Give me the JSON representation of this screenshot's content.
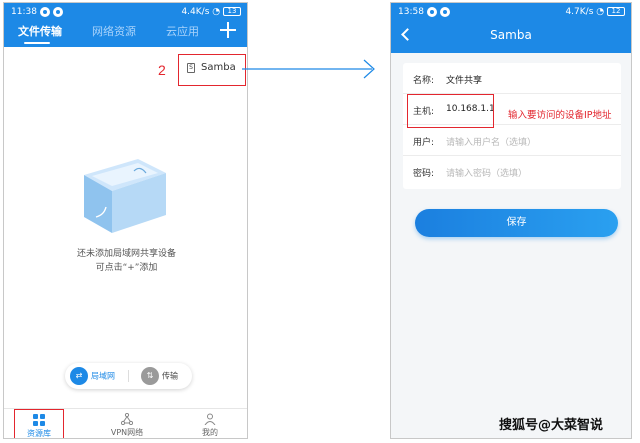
{
  "left_phone": {
    "status": {
      "time": "11:38",
      "speed": "4.4K/s",
      "battery": "13"
    },
    "tabs": [
      {
        "label": "文件传输"
      },
      {
        "label": "网络资源"
      },
      {
        "label": "云应用"
      }
    ],
    "step_number": "2",
    "add_menu": {
      "item_label": "Samba"
    },
    "empty_state": {
      "line1": "还未添加局域网共享设备",
      "line2": "可点击“+”添加"
    },
    "toggle": {
      "lan_label": "局域网",
      "transfer_label": "传输"
    },
    "bottom_nav": [
      {
        "label": "资源库",
        "icon": "grid-icon"
      },
      {
        "label": "VPN网络",
        "icon": "network-icon"
      },
      {
        "label": "我的",
        "icon": "person-icon"
      }
    ]
  },
  "right_phone": {
    "status": {
      "time": "13:58",
      "speed": "4.7K/s",
      "battery": "12"
    },
    "title": "Samba",
    "fields": [
      {
        "label": "名称:",
        "value": "文件共享",
        "placeholder": ""
      },
      {
        "label": "主机:",
        "value": "10.168.1.1",
        "placeholder": ""
      },
      {
        "label": "用户:",
        "value": "",
        "placeholder": "请输入用户名（选填）"
      },
      {
        "label": "密码:",
        "value": "",
        "placeholder": "请输入密码（选填）"
      }
    ],
    "host_annotation": "输入要访问的设备IP地址",
    "save_label": "保存"
  },
  "watermark": "搜狐号@大菜智说",
  "colors": {
    "accent": "#1d89e6",
    "annotation_red": "#e3262e"
  }
}
